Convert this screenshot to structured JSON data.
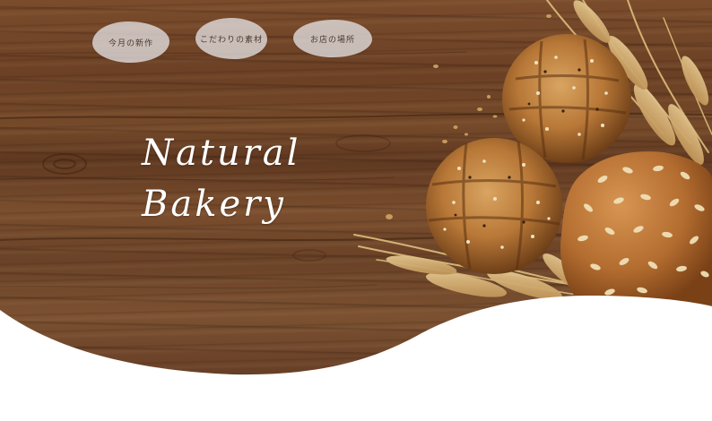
{
  "nav": {
    "items": [
      {
        "label": "今月の新作"
      },
      {
        "label": "こだわりの素材"
      },
      {
        "label": "お店の場所"
      }
    ]
  },
  "hero": {
    "title_line1": "Natural",
    "title_line2": "Bakery"
  },
  "colors": {
    "wood": "#6f4529",
    "pill": "#ebebf0",
    "title": "#ffffff",
    "bread": "#b9773c",
    "wave": "#ffffff"
  },
  "images": {
    "background": "wooden-table-photo",
    "foreground": "bread-rolls-and-wheat-photo"
  }
}
